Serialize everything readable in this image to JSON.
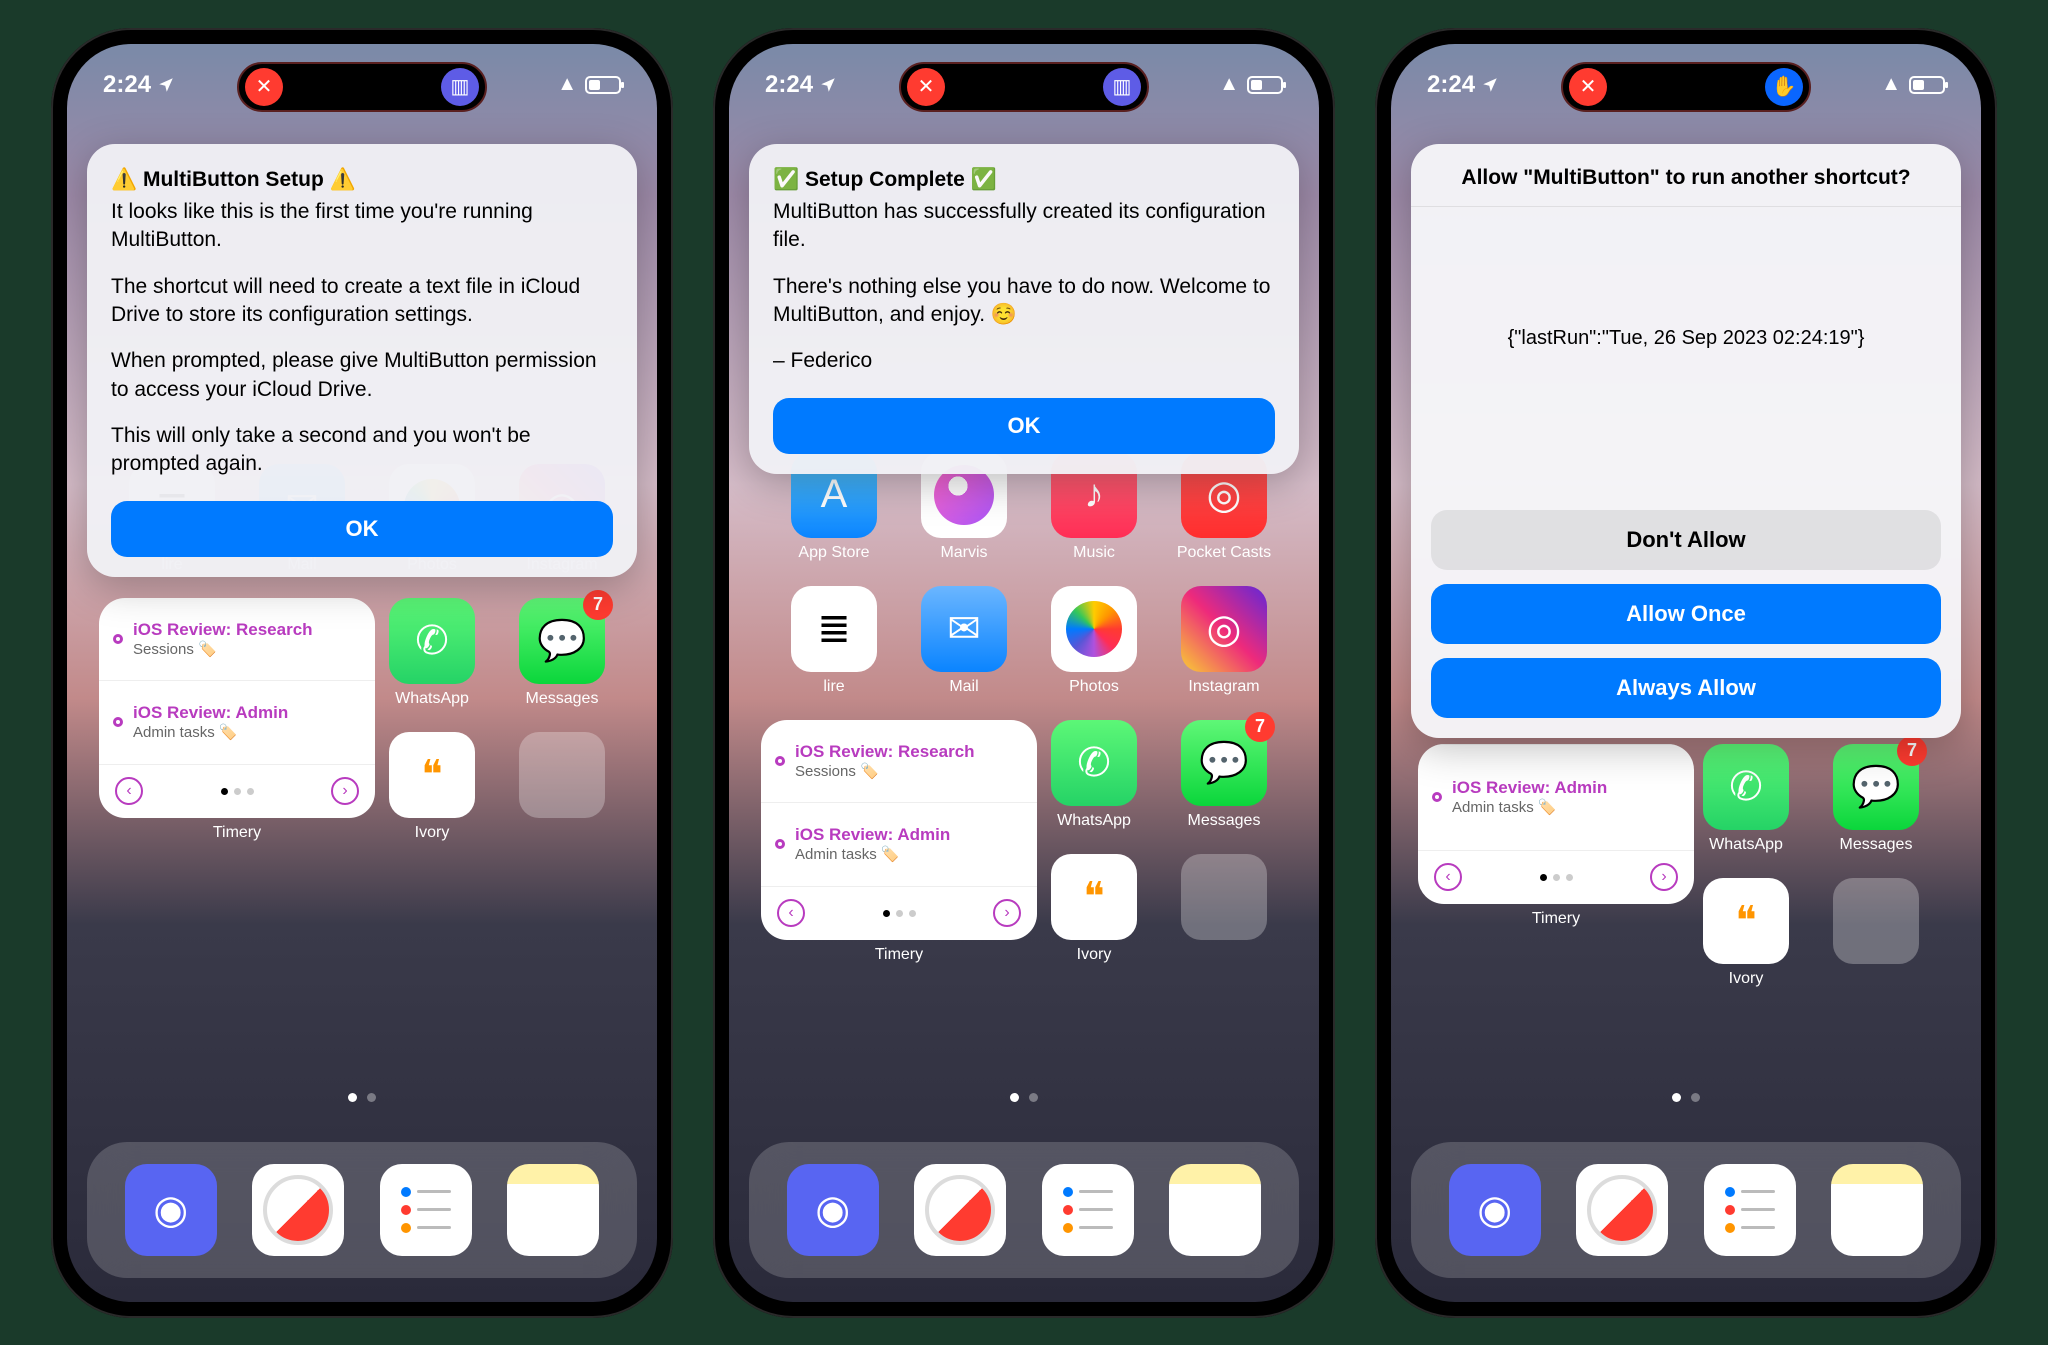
{
  "status": {
    "time": "2:24"
  },
  "screen1": {
    "alert_title": "⚠️ MultiButton Setup ⚠️",
    "alert_p1": "It looks like this is the first time you're running MultiButton.",
    "alert_p2": "The shortcut will need to create a text file in iCloud Drive to store its configuration settings.",
    "alert_p3": "When prompted, please give MultiButton permission to access your iCloud Drive.",
    "alert_p4": "This will only take a second and you won't be prompted again.",
    "ok": "OK"
  },
  "screen2": {
    "alert_title": "✅ Setup Complete ✅",
    "alert_p1": "MultiButton has successfully created its configuration file.",
    "alert_p2": "There's nothing else you have to do now. Welcome to MultiButton, and enjoy. ☺️",
    "alert_p3": "– Federico",
    "ok": "OK"
  },
  "screen3": {
    "perm_title": "Allow \"MultiButton\" to run another shortcut?",
    "json_text": "{\"lastRun\":\"Tue, 26 Sep 2023 02:24:19\"}",
    "dont_allow": "Don't Allow",
    "allow_once": "Allow Once",
    "always_allow": "Always Allow"
  },
  "apps": {
    "appstore": "App Store",
    "marvis": "Marvis",
    "music": "Music",
    "pocket": "Pocket Casts",
    "lire": "lire",
    "mail": "Mail",
    "photos": "Photos",
    "instagram": "Instagram",
    "whatsapp": "WhatsApp",
    "messages": "Messages",
    "messages_badge": "7",
    "timery": "Timery",
    "ivory": "Ivory"
  },
  "widget": {
    "row1_title": "iOS Review: Research",
    "row1_sub": "Sessions 🏷️",
    "row2_title": "iOS Review: Admin",
    "row2_sub": "Admin tasks 🏷️"
  }
}
